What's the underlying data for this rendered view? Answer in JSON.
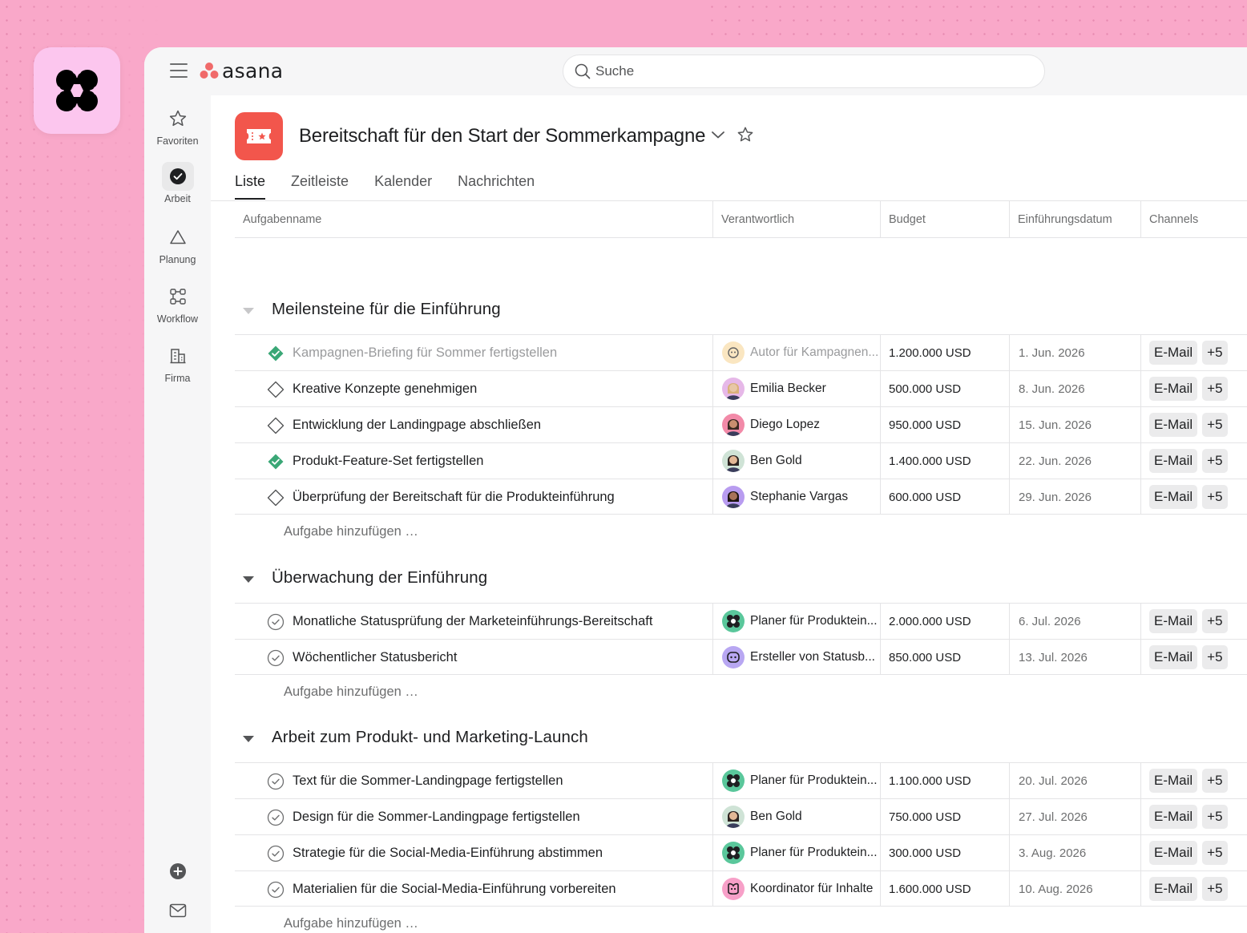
{
  "colors": {
    "background": "#f9a8c9",
    "logo_tile": "#fcc6ee",
    "project_icon": "#f2564c",
    "done_check": "#3aa776",
    "asana_dots": "#f06a6a"
  },
  "topbar": {
    "brand": "asana",
    "search_placeholder": "Suche"
  },
  "sidebar": {
    "items": [
      {
        "label": "Favoriten",
        "icon": "star-icon"
      },
      {
        "label": "Arbeit",
        "icon": "check-circle-icon"
      },
      {
        "label": "Planung",
        "icon": "triangle-icon"
      },
      {
        "label": "Workflow",
        "icon": "workflow-icon"
      },
      {
        "label": "Firma",
        "icon": "building-icon"
      }
    ],
    "bottom_icons": [
      "plus-circle-icon",
      "mail-icon",
      "user-avatar"
    ]
  },
  "project": {
    "title": "Bereitschaft für den Start der Sommerkampagne",
    "tabs": [
      "Liste",
      "Zeitleiste",
      "Kalender",
      "Nachrichten"
    ],
    "active_tab": "Liste"
  },
  "columns": [
    "Aufgabenname",
    "Verantwortlich",
    "Budget",
    "Einführungsdatum",
    "Channels"
  ],
  "add_task_label": "Aufgabe hinzufügen …",
  "sections": [
    {
      "title": "Meilensteine für die Einführung",
      "tasks": [
        {
          "name": "Kampagnen-Briefing für Sommer fertigstellen",
          "assignee": "Autor für Kampagnen...",
          "budget": "1.200.000 USD",
          "date": "1. Jun. 2026",
          "channel": "E-Mail",
          "more": "+5",
          "status": "done-milestone"
        },
        {
          "name": "Kreative Konzepte genehmigen",
          "assignee": "Emilia Becker",
          "budget": "500.000 USD",
          "date": "8. Jun. 2026",
          "channel": "E-Mail",
          "more": "+5",
          "status": "milestone"
        },
        {
          "name": "Entwicklung der Landingpage abschließen",
          "assignee": "Diego Lopez",
          "budget": "950.000 USD",
          "date": "15. Jun. 2026",
          "channel": "E-Mail",
          "more": "+5",
          "status": "milestone"
        },
        {
          "name": "Produkt-Feature-Set fertigstellen",
          "assignee": "Ben Gold",
          "budget": "1.400.000 USD",
          "date": "22. Jun. 2026",
          "channel": "E-Mail",
          "more": "+5",
          "status": "done-milestone-active"
        },
        {
          "name": "Überprüfung der Bereitschaft für die Produkteinführung",
          "assignee": "Stephanie Vargas",
          "budget": "600.000 USD",
          "date": "29. Jun. 2026",
          "channel": "E-Mail",
          "more": "+5",
          "status": "milestone"
        }
      ]
    },
    {
      "title": "Überwachung der Einführung",
      "tasks": [
        {
          "name": "Monatliche Statusprüfung der Marketeinführungs-Bereitschaft",
          "assignee": "Planer für Produktein...",
          "budget": "2.000.000 USD",
          "date": "6. Jul. 2026",
          "channel": "E-Mail",
          "more": "+5",
          "status": "task"
        },
        {
          "name": "Wöchentlicher Statusbericht",
          "assignee": "Ersteller von Statusb...",
          "budget": "850.000 USD",
          "date": "13. Jul. 2026",
          "channel": "E-Mail",
          "more": "+5",
          "status": "task"
        }
      ]
    },
    {
      "title": "Arbeit zum Produkt- und Marketing-Launch",
      "tasks": [
        {
          "name": "Text für die Sommer-Landingpage fertigstellen",
          "assignee": "Planer für Produktein...",
          "budget": "1.100.000 USD",
          "date": "20. Jul. 2026",
          "channel": "E-Mail",
          "more": "+5",
          "status": "task"
        },
        {
          "name": "Design für die Sommer-Landingpage fertigstellen",
          "assignee": "Ben Gold",
          "budget": "750.000 USD",
          "date": "27. Jul. 2026",
          "channel": "E-Mail",
          "more": "+5",
          "status": "task"
        },
        {
          "name": "Strategie für die Social-Media-Einführung abstimmen",
          "assignee": "Planer für Produktein...",
          "budget": "300.000 USD",
          "date": "3. Aug. 2026",
          "channel": "E-Mail",
          "more": "+5",
          "status": "task"
        },
        {
          "name": "Materialien für die Social-Media-Einführung vorbereiten",
          "assignee": "Koordinator für Inhalte",
          "budget": "1.600.000 USD",
          "date": "10. Aug. 2026",
          "channel": "E-Mail",
          "more": "+5",
          "status": "task"
        }
      ]
    }
  ]
}
